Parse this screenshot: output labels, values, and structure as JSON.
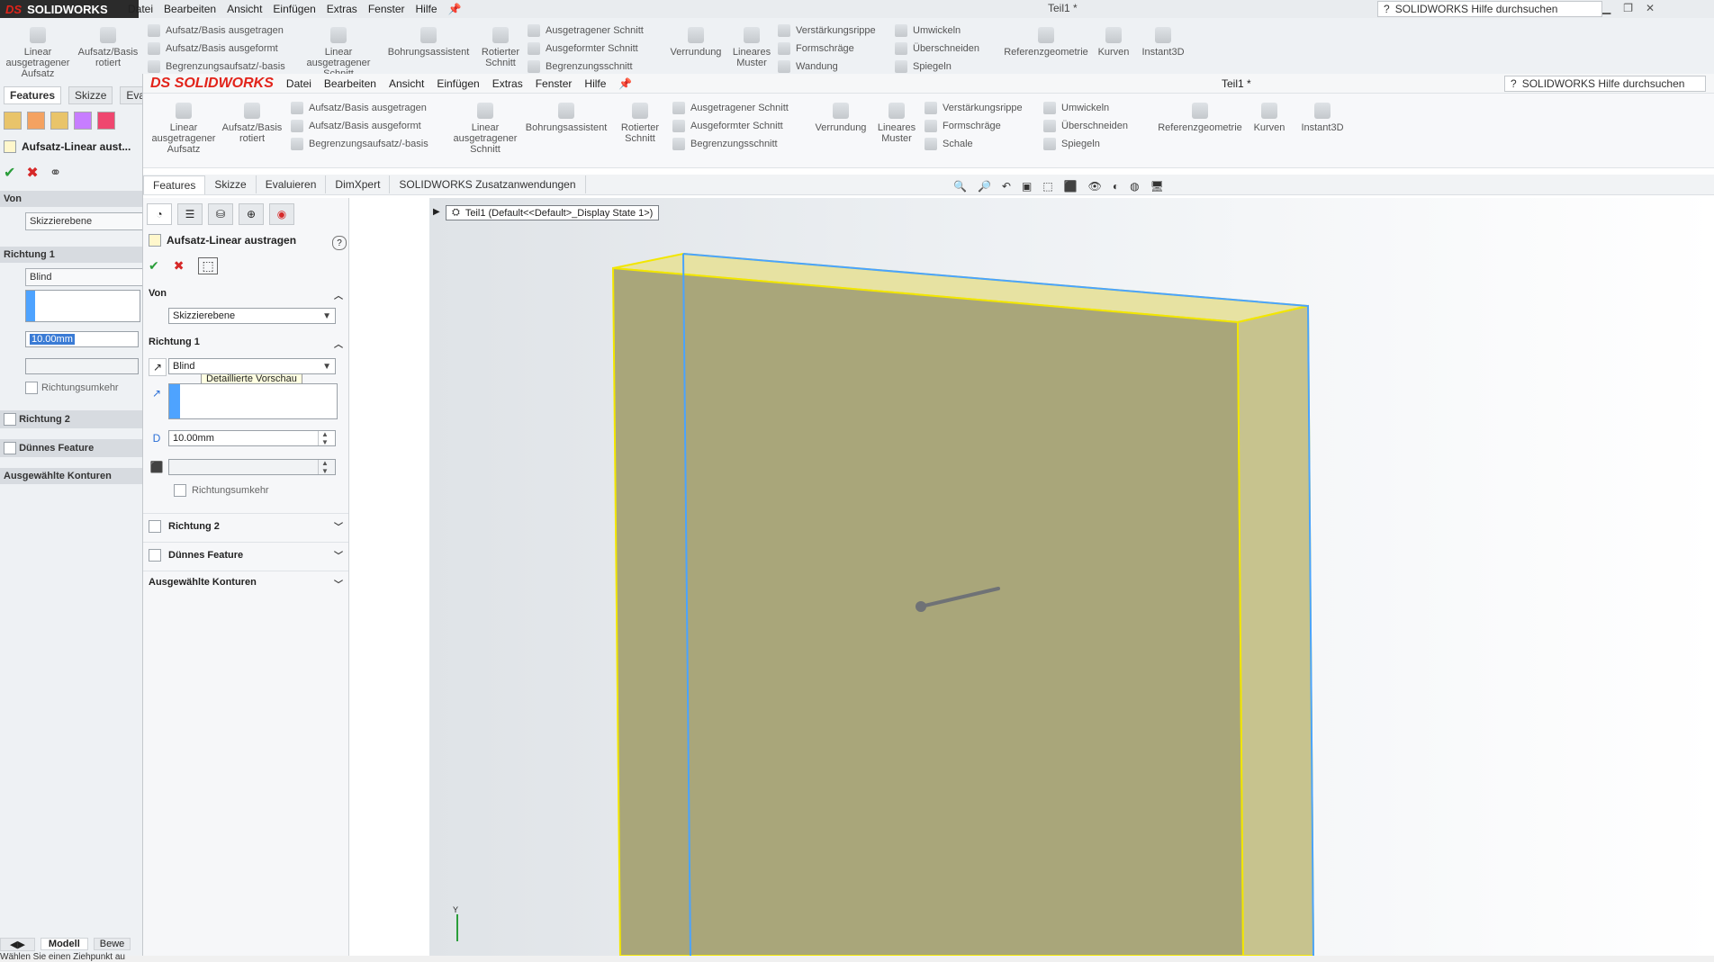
{
  "background_app": {
    "logo_text": "SOLIDWORKS",
    "logo_ds": "DS",
    "menu": [
      "Datei",
      "Bearbeiten",
      "Ansicht",
      "Einfügen",
      "Extras",
      "Fenster",
      "Hilfe"
    ],
    "title": "Teil1 *",
    "search_placeholder": "SOLIDWORKS Hilfe durchsuchen",
    "ribbon": {
      "big": [
        {
          "label": "Linear ausgetragener Aufsatz"
        },
        {
          "label": "Aufsatz/Basis rotiert"
        },
        {
          "label": "Linear ausgetragener Schnitt"
        },
        {
          "label": "Bohrungsassistent"
        },
        {
          "label": "Rotierter Schnitt"
        },
        {
          "label": "Verrundung"
        },
        {
          "label": "Lineares Muster"
        },
        {
          "label": "Referenzgeometrie"
        },
        {
          "label": "Kurven"
        },
        {
          "label": "Instant3D"
        }
      ],
      "small_col1": [
        "Aufsatz/Basis ausgetragen",
        "Aufsatz/Basis ausgeformt",
        "Begrenzungsaufsatz/-basis"
      ],
      "small_col2": [
        "Ausgetragener Schnitt",
        "Ausgeformter Schnitt",
        "Begrenzungsschnitt"
      ],
      "small_col3": [
        "Verstärkungsrippe",
        "Formschräge",
        "Wandung"
      ],
      "small_col4": [
        "Umwickeln",
        "Überschneiden",
        "Spiegeln"
      ]
    },
    "tabs": [
      "Features",
      "Skizze",
      "Evaluie"
    ],
    "pm": {
      "title": "Aufsatz-Linear aust...",
      "von_label": "Von",
      "von_value": "Skizzierebene",
      "richtung1_label": "Richtung 1",
      "richtung1_value": "Blind",
      "depth_value": "10.00mm",
      "reverse_label": "Richtungsumkehr",
      "richtung2_label": "Richtung 2",
      "thin_label": "Dünnes Feature",
      "contours_label": "Ausgewählte Konturen"
    },
    "status_tab_model": "Modell",
    "status_tab_motion": "Bewe",
    "status_hint": "Wählen Sie einen Ziehpunkt au"
  },
  "main_app": {
    "logo_text": "SOLIDWORKS",
    "logo_ds": "DS",
    "menu": [
      "Datei",
      "Bearbeiten",
      "Ansicht",
      "Einfügen",
      "Extras",
      "Fenster",
      "Hilfe"
    ],
    "title": "Teil1 *",
    "search_placeholder": "SOLIDWORKS Hilfe durchsuchen",
    "ribbon": {
      "big": [
        {
          "label": "Linear ausgetragener Aufsatz"
        },
        {
          "label": "Aufsatz/Basis rotiert"
        },
        {
          "label": "Linear ausgetragener Schnitt"
        },
        {
          "label": "Bohrungsassistent"
        },
        {
          "label": "Rotierter Schnitt"
        },
        {
          "label": "Verrundung"
        },
        {
          "label": "Lineares Muster"
        },
        {
          "label": "Referenzgeometrie"
        },
        {
          "label": "Kurven"
        },
        {
          "label": "Instant3D"
        }
      ],
      "small_col1": [
        "Aufsatz/Basis ausgetragen",
        "Aufsatz/Basis ausgeformt",
        "Begrenzungsaufsatz/-basis"
      ],
      "small_col2": [
        "Ausgetragener Schnitt",
        "Ausgeformter Schnitt",
        "Begrenzungsschnitt"
      ],
      "small_col3": [
        "Verstärkungsrippe",
        "Formschräge",
        "Schale"
      ],
      "small_col4": [
        "Umwickeln",
        "Überschneiden",
        "Spiegeln"
      ]
    },
    "tabs": [
      "Features",
      "Skizze",
      "Evaluieren",
      "DimXpert",
      "SOLIDWORKS Zusatzanwendungen"
    ],
    "property_manager": {
      "title": "Aufsatz-Linear austragen",
      "tooltip": "Detaillierte Vorschau",
      "von_label": "Von",
      "von_value": "Skizzierebene",
      "richtung1_label": "Richtung 1",
      "richtung1_value": "Blind",
      "depth_value": "10.00mm",
      "reverse_label": "Richtungsumkehr",
      "richtung2_label": "Richtung 2",
      "thin_label": "Dünnes Feature",
      "contours_label": "Ausgewählte Konturen"
    },
    "breadcrumb": "Teil1  (Default<<Default>_Display State 1>)",
    "axis_label": "Y"
  }
}
